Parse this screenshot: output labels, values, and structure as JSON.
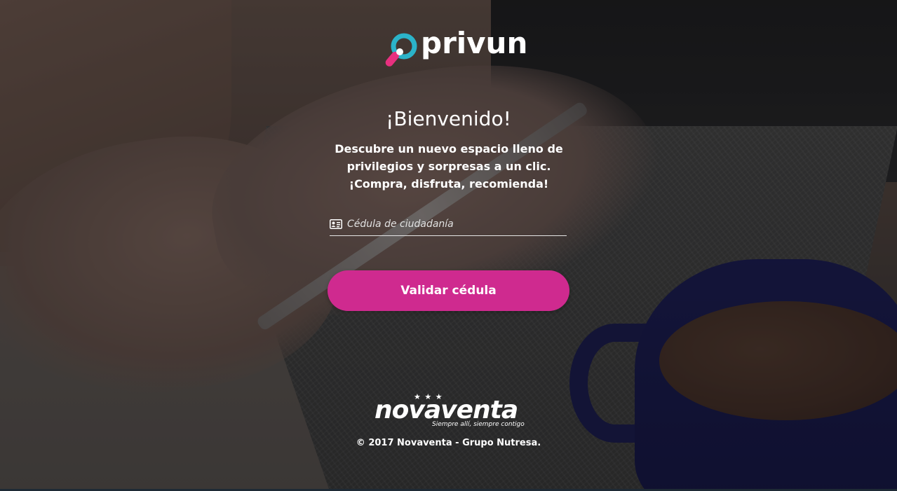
{
  "brand": {
    "name": "privun",
    "accent_color": "#cf2a8f",
    "mark_colors": [
      "#2bb3c9",
      "#e8307f"
    ]
  },
  "welcome": {
    "title": "¡Bienvenido!",
    "lines": [
      "Descubre un nuevo espacio lleno de",
      "privilegios y sorpresas a un clic.",
      "¡Compra, disfruta, recomienda!"
    ]
  },
  "form": {
    "id_field": {
      "icon": "id-card-icon",
      "placeholder": "Cédula de ciudadanía",
      "value": ""
    },
    "submit_label": "Validar cédula"
  },
  "footer": {
    "logo_word": "novaventa",
    "logo_stars": "★ ★ ★",
    "tagline": "Siempre allí, siempre contigo",
    "copyright": "© 2017 Novaventa - Grupo Nutresa."
  }
}
